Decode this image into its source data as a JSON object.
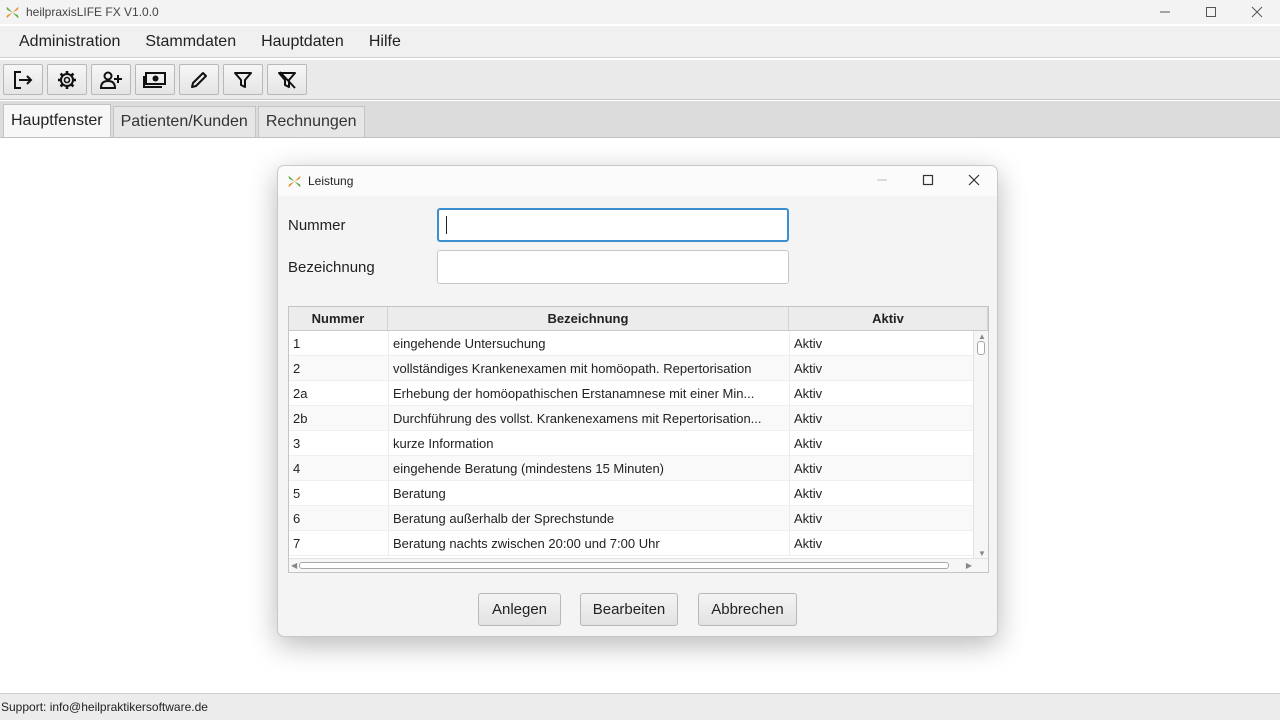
{
  "window": {
    "title": "heilpraxisLIFE FX V1.0.0",
    "controls": [
      "minimize-icon",
      "maximize-icon",
      "close-icon"
    ]
  },
  "menu": {
    "items": [
      "Administration",
      "Stammdaten",
      "Hauptdaten",
      "Hilfe"
    ]
  },
  "toolbar": {
    "buttons": [
      "logout-icon",
      "settings-gear-icon",
      "add-user-icon",
      "money-icon",
      "edit-pencil-icon",
      "filter-icon",
      "clear-filter-icon"
    ]
  },
  "tabs": [
    {
      "label": "Hauptfenster",
      "active": true
    },
    {
      "label": "Patienten/Kunden",
      "active": false
    },
    {
      "label": "Rechnungen",
      "active": false
    }
  ],
  "dialog": {
    "title": "Leistung",
    "nummer_label": "Nummer",
    "nummer_value": "",
    "bezeichnung_label": "Bezeichnung",
    "bezeichnung_value": "",
    "table": {
      "columns": [
        "Nummer",
        "Bezeichnung",
        "Aktiv"
      ],
      "rows": [
        [
          "1",
          "eingehende Untersuchung",
          "Aktiv"
        ],
        [
          "2",
          "vollständiges Krankenexamen mit homöopath. Repertorisation",
          "Aktiv"
        ],
        [
          "2a",
          "Erhebung der homöopathischen Erstanamnese mit einer Min...",
          "Aktiv"
        ],
        [
          "2b",
          "Durchführung des vollst. Krankenexamens mit Repertorisation...",
          "Aktiv"
        ],
        [
          "3",
          "kurze Information",
          "Aktiv"
        ],
        [
          "4",
          "eingehende Beratung (mindestens 15 Minuten)",
          "Aktiv"
        ],
        [
          "5",
          "Beratung",
          "Aktiv"
        ],
        [
          "6",
          "Beratung außerhalb der Sprechstunde",
          "Aktiv"
        ],
        [
          "7",
          "Beratung nachts zwischen 20:00 und 7:00 Uhr",
          "Aktiv"
        ]
      ]
    },
    "buttons": {
      "anlegen": "Anlegen",
      "bearbeiten": "Bearbeiten",
      "abbrechen": "Abbrechen"
    }
  },
  "status": {
    "text": "Support: info@heilpraktikersoftware.de"
  },
  "colors": {
    "focus_border": "#3c8fce",
    "logo_green": "#5aa83c",
    "logo_orange": "#e8902a"
  }
}
